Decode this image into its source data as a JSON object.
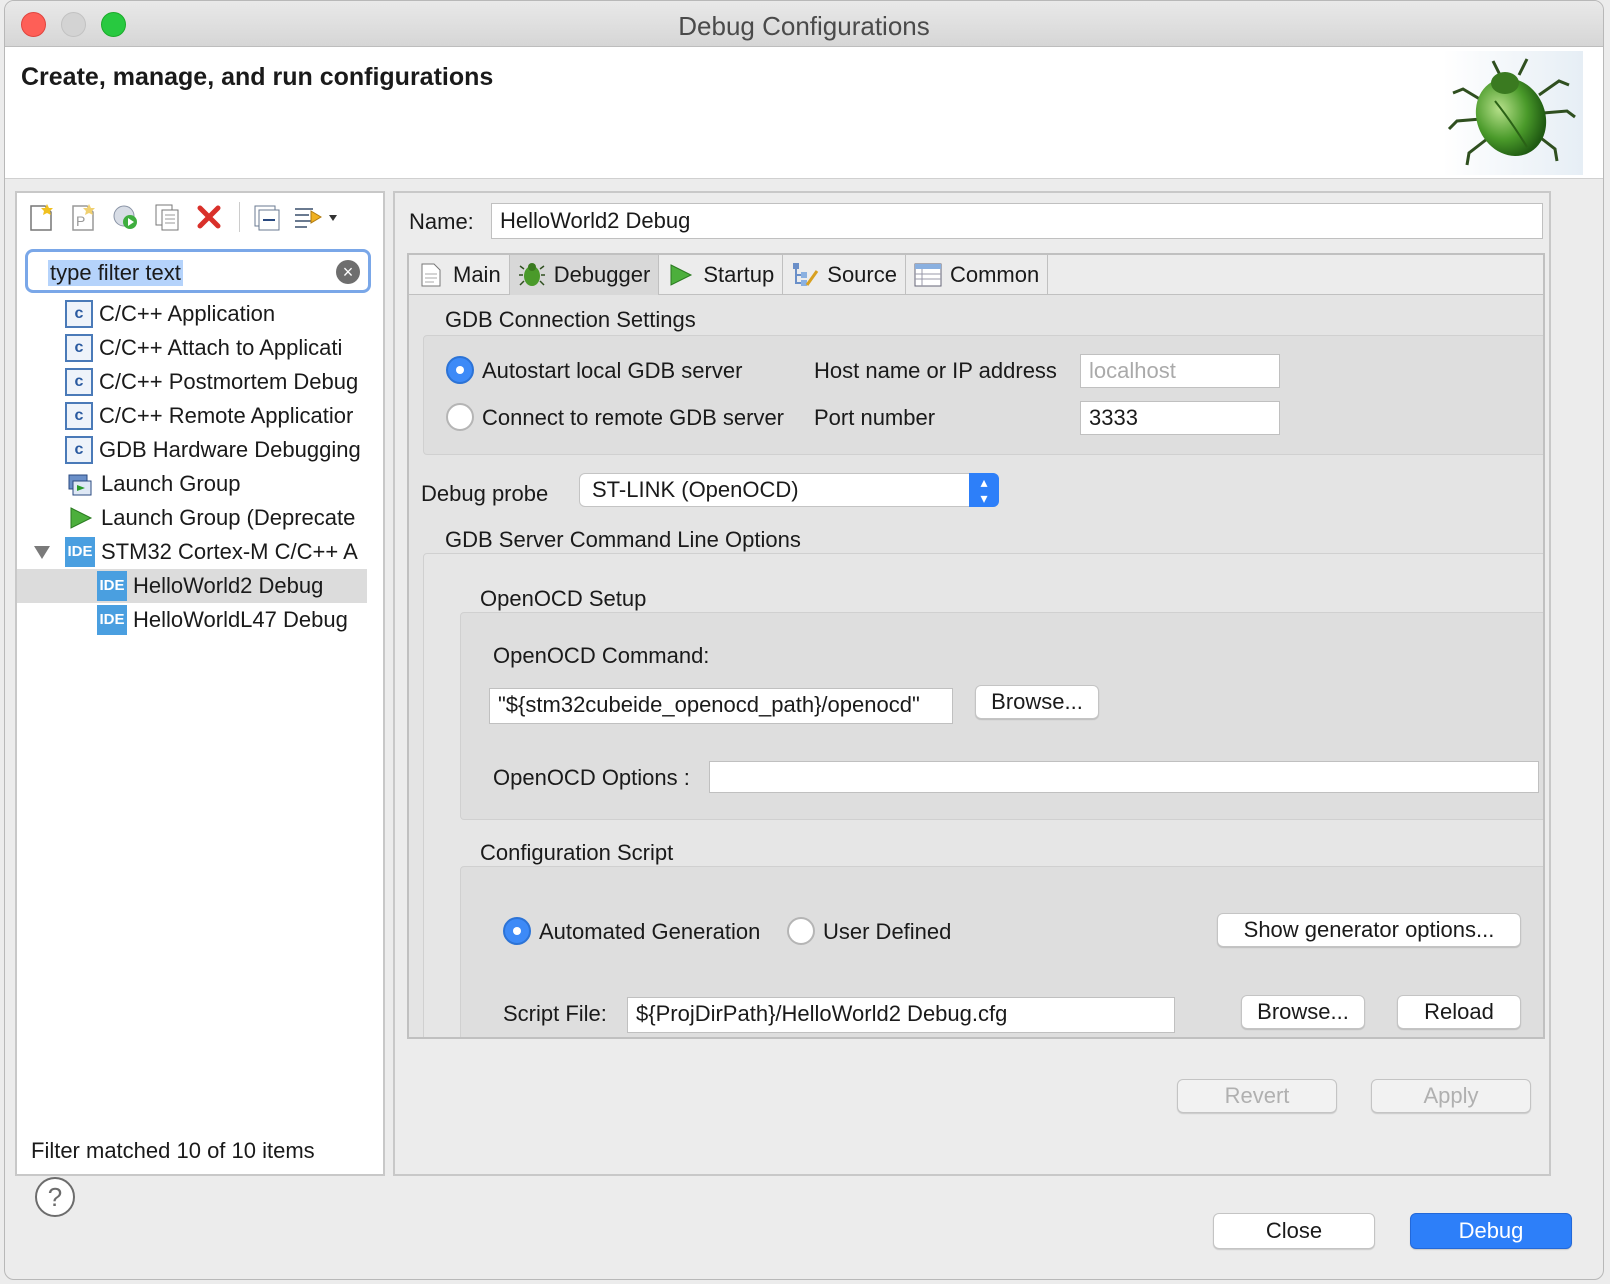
{
  "window": {
    "title": "Debug Configurations"
  },
  "header": {
    "title": "Create, manage, and run configurations"
  },
  "left": {
    "filter_placeholder": "type filter text",
    "tree": [
      {
        "label": "C/C++ Application",
        "icon": "c-config-icon",
        "level": 1
      },
      {
        "label": "C/C++ Attach to Applicati",
        "icon": "c-config-icon",
        "level": 1
      },
      {
        "label": "C/C++ Postmortem Debug",
        "icon": "c-config-icon",
        "level": 1
      },
      {
        "label": "C/C++ Remote Applicatior",
        "icon": "c-config-icon",
        "level": 1
      },
      {
        "label": "GDB Hardware Debugging",
        "icon": "c-config-icon",
        "level": 1
      },
      {
        "label": "Launch Group",
        "icon": "launch-group-icon",
        "level": 1
      },
      {
        "label": "Launch Group (Deprecate",
        "icon": "launch-group-deprecated-icon",
        "level": 1
      },
      {
        "label": "STM32 Cortex-M C/C++ A",
        "icon": "ide-icon",
        "level": 1,
        "expanded": true
      },
      {
        "label": "HelloWorld2 Debug",
        "icon": "ide-icon",
        "level": 2,
        "selected": true
      },
      {
        "label": "HelloWorldL47 Debug",
        "icon": "ide-icon",
        "level": 2
      }
    ],
    "ide_badge": "IDE",
    "c_badge": "c",
    "status": "Filter matched 10 of 10 items"
  },
  "right": {
    "name_label": "Name:",
    "name_value": "HelloWorld2 Debug",
    "tabs": [
      "Main",
      "Debugger",
      "Startup",
      "Source",
      "Common"
    ],
    "active_tab": "Debugger",
    "gdb_connection": {
      "title": "GDB Connection Settings",
      "autostart_label": "Autostart local GDB server",
      "remote_label": "Connect to remote GDB server",
      "host_label": "Host name or IP address",
      "host_value": "localhost",
      "port_label": "Port number",
      "port_value": "3333"
    },
    "debug_probe": {
      "label": "Debug probe",
      "value": "ST-LINK (OpenOCD)"
    },
    "server_options": {
      "title": "GDB Server Command Line Options",
      "openocd_setup_title": "OpenOCD Setup",
      "command_label": "OpenOCD Command:",
      "command_value": "\"${stm32cubeide_openocd_path}/openocd\"",
      "browse_label": "Browse...",
      "options_label": "OpenOCD Options :",
      "options_value": ""
    },
    "config_script": {
      "title": "Configuration Script",
      "automated_label": "Automated Generation",
      "user_defined_label": "User Defined",
      "generator_button": "Show generator options...",
      "script_label": "Script File:",
      "script_value": "${ProjDirPath}/HelloWorld2 Debug.cfg",
      "browse_label": "Browse...",
      "reload_label": "Reload"
    },
    "revert_label": "Revert",
    "apply_label": "Apply"
  },
  "footer": {
    "help_label": "?",
    "close_label": "Close",
    "debug_label": "Debug"
  },
  "colors": {
    "accent": "#2d7ff9",
    "delete": "#d9302a",
    "selection": "#dcdcdc"
  }
}
